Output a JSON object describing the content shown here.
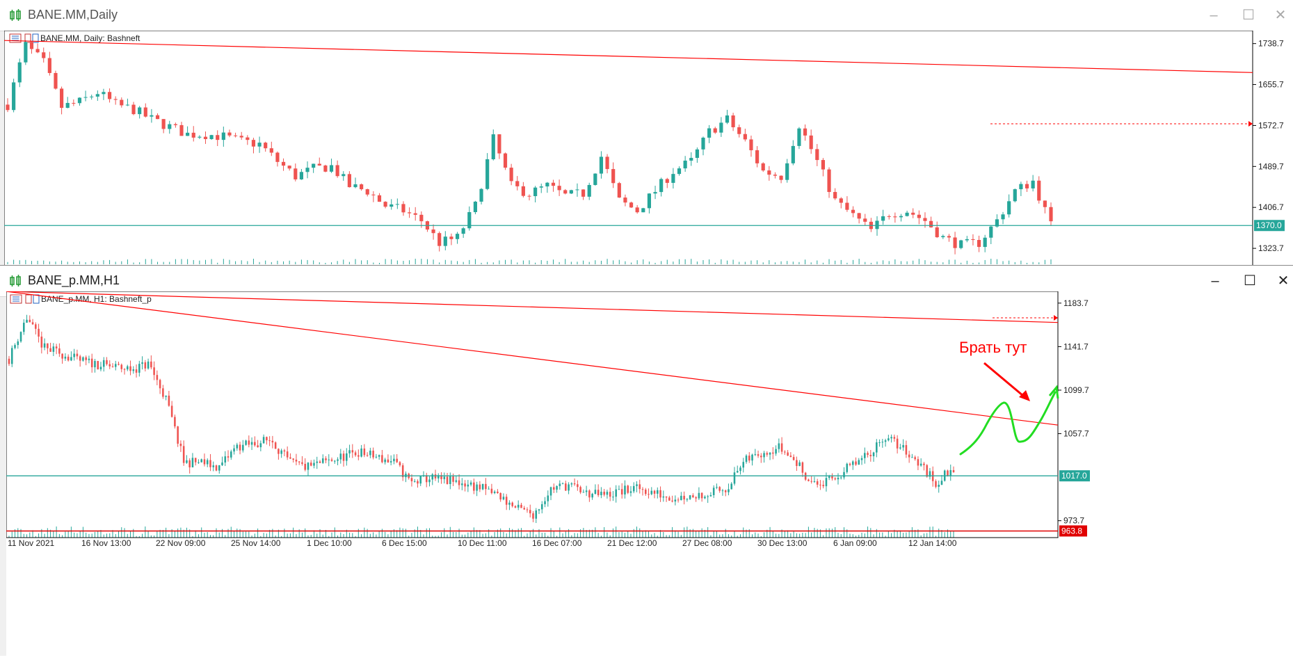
{
  "windows": [
    {
      "id": "daily",
      "title": "BANE.MM,Daily",
      "header_label": "BANE.MM, Daily:  Bashneft",
      "inactive": true,
      "price_labels": [
        "1738.7",
        "1655.7",
        "1572.7",
        "1489.7",
        "1406.7",
        "1323.7"
      ],
      "price_ticks": [
        1738.7,
        1655.7,
        1572.7,
        1489.7,
        1406.7,
        1323.7
      ],
      "current_price": "1370.0",
      "current_price_value": 1370.0,
      "y_range": [
        1290,
        1765
      ]
    },
    {
      "id": "h1",
      "title": "BANE_p.MM,H1",
      "header_label": "BANE_p.MM, H1:  Bashneft_p",
      "inactive": false,
      "price_labels": [
        "1183.7",
        "1141.7",
        "1099.7",
        "1057.7",
        "973.7"
      ],
      "price_ticks": [
        1183.7,
        1141.7,
        1099.7,
        1057.7,
        973.7
      ],
      "current_price": "1017.0",
      "current_price_value": 1017.0,
      "support_price": "963.8",
      "support_price_value": 963.8,
      "y_range": [
        950,
        1195
      ],
      "time_labels": [
        "11 Nov 2021",
        "16 Nov 13:00",
        "22 Nov 09:00",
        "25 Nov 14:00",
        "1 Dec 10:00",
        "6 Dec 15:00",
        "10 Dec 11:00",
        "16 Dec 07:00",
        "21 Dec 12:00",
        "27 Dec 08:00",
        "30 Dec 13:00",
        "6 Jan 09:00",
        "12 Jan 14:00"
      ],
      "annotation_text": "Брать тут"
    }
  ],
  "colors": {
    "bull": "#26a69a",
    "bear": "#ef5350",
    "trendline": "#ff0000",
    "level": "#26a69a",
    "support": "#e00000",
    "annotation": "#ff0000",
    "forecast": "#22dd22"
  },
  "chart_data": [
    {
      "type": "candlestick",
      "symbol": "BANE.MM",
      "timeframe": "Daily",
      "description": "Bashneft",
      "ylim": [
        1290,
        1765
      ],
      "y_ticks": [
        1738.7,
        1655.7,
        1572.7,
        1489.7,
        1406.7,
        1323.7
      ],
      "close_path": [
        1615,
        1735,
        1700,
        1610,
        1620,
        1640,
        1615,
        1605,
        1585,
        1570,
        1555,
        1555,
        1550,
        1540,
        1535,
        1500,
        1470,
        1485,
        1490,
        1450,
        1440,
        1410,
        1400,
        1380,
        1335,
        1345,
        1410,
        1545,
        1450,
        1435,
        1450,
        1430,
        1435,
        1510,
        1420,
        1400,
        1440,
        1480,
        1500,
        1560,
        1585,
        1540,
        1480,
        1470,
        1575,
        1500,
        1420,
        1390,
        1360,
        1395,
        1400,
        1380,
        1345,
        1330,
        1335,
        1380,
        1440,
        1460,
        1370
      ],
      "current_price": 1370.0,
      "trendline": {
        "from": 1745,
        "to": 1680
      }
    },
    {
      "type": "candlestick",
      "symbol": "BANE_p.MM",
      "timeframe": "H1",
      "description": "Bashneft_p",
      "ylim": [
        950,
        1195
      ],
      "y_ticks": [
        1183.7,
        1141.7,
        1099.7,
        1057.7,
        973.7
      ],
      "x_ticks": [
        "11 Nov 2021",
        "16 Nov 13:00",
        "22 Nov 09:00",
        "25 Nov 14:00",
        "1 Dec 10:00",
        "6 Dec 15:00",
        "10 Dec 11:00",
        "16 Dec 07:00",
        "21 Dec 12:00",
        "27 Dec 08:00",
        "30 Dec 13:00",
        "6 Jan 09:00",
        "12 Jan 14:00"
      ],
      "close_path": [
        1130,
        1170,
        1140,
        1135,
        1128,
        1125,
        1122,
        1120,
        1125,
        1090,
        1030,
        1030,
        1025,
        1045,
        1048,
        1052,
        1030,
        1025,
        1030,
        1035,
        1040,
        1035,
        1030,
        1010,
        1015,
        1012,
        1010,
        1005,
        998,
        985,
        980,
        1005,
        1008,
        1000,
        998,
        1002,
        1005,
        1000,
        996,
        998,
        1000,
        1005,
        1030,
        1040,
        1045,
        1030,
        1008,
        1012,
        1025,
        1035,
        1055,
        1045,
        1030,
        1010,
        1025
      ],
      "current_price": 1017.0,
      "support_level": 963.8,
      "trendlines": [
        {
          "from": 1195,
          "to": 1165
        },
        {
          "from": 1195,
          "to": 1066
        }
      ],
      "annotation": "Брать тут"
    }
  ]
}
